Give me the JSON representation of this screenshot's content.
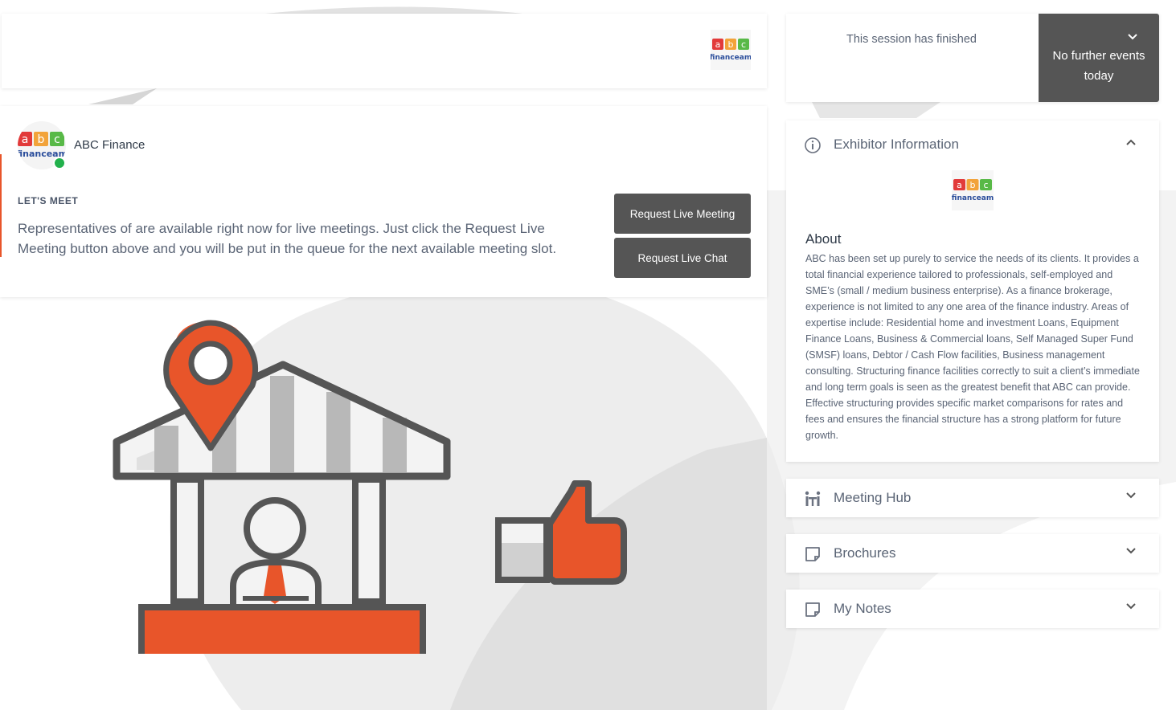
{
  "banner": {
    "logo_alt": "abc financeam logo"
  },
  "exhibitor": {
    "name": "ABC Finance",
    "section_label": "LET'S MEET",
    "description": "Representatives of are available right now for live meetings. Just click the Request Live Meeting button above and you will be put in the queue for the next available meeting slot.",
    "online": true
  },
  "buttons": {
    "request_meeting": "Request Live Meeting",
    "request_chat": "Request Live Chat"
  },
  "session": {
    "message": "This session has finished",
    "dropdown_label": "No further events today"
  },
  "info_panel": {
    "title": "Exhibitor Information",
    "expanded": true,
    "about_title": "About",
    "about_text": "ABC has been set up purely to service the needs of its clients. It provides a total financial experience tailored to professionals, self-employed and SME’s (small / medium business enterprise). As a finance brokerage, experience is not limited to any one area of the finance industry. Areas of expertise include: Residential home and investment Loans, Equipment Finance Loans, Business & Commercial loans, Self Managed Super Fund (SMSF) loans, Debtor / Cash Flow facilities, Business management consulting. Structuring finance facilities correctly to suit a client’s immediate and long term goals is seen as the greatest benefit that ABC can provide. Effective structuring provides specific market comparisons for rates and fees and ensures the financial structure has a strong platform for future growth."
  },
  "panels": {
    "meeting_hub": "Meeting Hub",
    "brochures": "Brochures",
    "notes": "My Notes"
  },
  "colors": {
    "accent": "#e8552a",
    "dark_button": "#555555",
    "online": "#22b14c",
    "logo_red": "#e23a3a",
    "logo_orange": "#f2a33a",
    "logo_green": "#58b947",
    "logo_text": "#2a4d9b"
  }
}
